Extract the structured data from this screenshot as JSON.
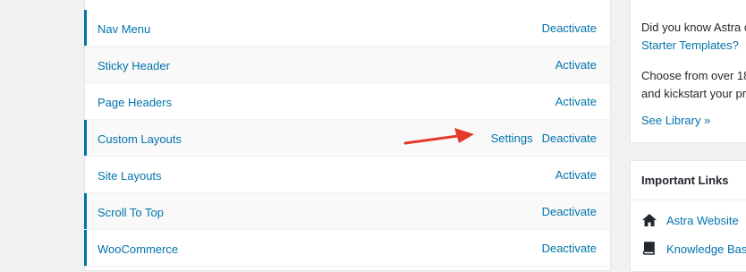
{
  "modules": [
    {
      "name": "Nav Menu",
      "actions": [
        "Deactivate"
      ],
      "active": true
    },
    {
      "name": "Sticky Header",
      "actions": [
        "Activate"
      ],
      "active": false
    },
    {
      "name": "Page Headers",
      "actions": [
        "Activate"
      ],
      "active": false
    },
    {
      "name": "Custom Layouts",
      "actions": [
        "Settings",
        "Deactivate"
      ],
      "active": true
    },
    {
      "name": "Site Layouts",
      "actions": [
        "Activate"
      ],
      "active": false
    },
    {
      "name": "Scroll To Top",
      "actions": [
        "Deactivate"
      ],
      "active": true
    },
    {
      "name": "WooCommerce",
      "actions": [
        "Deactivate"
      ],
      "active": true
    }
  ],
  "sidebar": {
    "promo": {
      "text_line1": "Did you know Astra c",
      "link_line": "Starter Templates?",
      "text_line3": "Choose from over 18",
      "text_line4": "and kickstart your pr",
      "see_library": "See Library »"
    },
    "important_links": {
      "title": "Important Links",
      "items": [
        {
          "label": "Astra Website",
          "icon": "home-icon"
        },
        {
          "label": "Knowledge Bas",
          "icon": "book-icon"
        }
      ]
    }
  },
  "colors": {
    "accent": "#0073aa",
    "arrow": "#e53a2b"
  }
}
